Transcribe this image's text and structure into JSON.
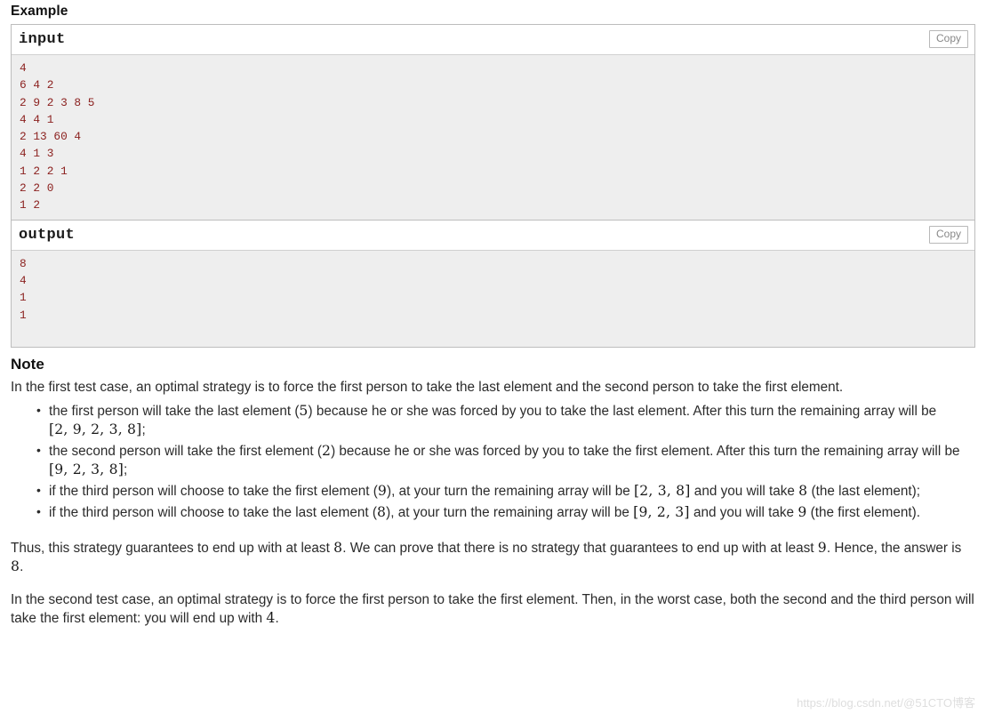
{
  "example": {
    "heading": "Example",
    "blocks": [
      {
        "title": "input",
        "copy_label": "Copy",
        "content": "4\n6 4 2\n2 9 2 3 8 5\n4 4 1\n2 13 60 4\n4 1 3\n1 2 2 1\n2 2 0\n1 2"
      },
      {
        "title": "output",
        "copy_label": "Copy",
        "content": "8\n4\n1\n1"
      }
    ]
  },
  "note": {
    "heading": "Note",
    "intro": "In the first test case, an optimal strategy is to force the first person to take the last element and the second person to take the first element.",
    "bullets": [
      {
        "t1": "the first person will take the last element (",
        "m1": "5",
        "t2": ") because he or she was forced by you to take the last element. After this turn the remaining array will be ",
        "m2": "[2, 9, 2, 3, 8]",
        "t3": ";"
      },
      {
        "t1": "the second person will take the first element (",
        "m1": "2",
        "t2": ") because he or she was forced by you to take the first element. After this turn the remaining array will be ",
        "m2": "[9, 2, 3, 8]",
        "t3": ";"
      },
      {
        "t1": "if the third person will choose to take the first element (",
        "m1": "9",
        "t2": "), at your turn the remaining array will be ",
        "m2": "[2, 3, 8]",
        "t3": " and you will take ",
        "m3": "8",
        "t4": " (the last element);"
      },
      {
        "t1": "if the third person will choose to take the last element (",
        "m1": "8",
        "t2": "), at your turn the remaining array will be ",
        "m2": "[9, 2, 3]",
        "t3": " and you will take ",
        "m3": "9",
        "t4": " (the first element)."
      }
    ],
    "conclusion": {
      "t1": "Thus, this strategy guarantees to end up with at least ",
      "m1": "8",
      "t2": ". We can prove that there is no strategy that guarantees to end up with at least ",
      "m2": "9",
      "t3": ". Hence, the answer is ",
      "m3": "8",
      "t4": "."
    },
    "second_case": {
      "t1": "In the second test case, an optimal strategy is to force the first person to take the first element. Then, in the worst case, both the second and the third person will take the first element: you will end up with ",
      "m1": "4",
      "t2": "."
    }
  },
  "watermark": {
    "text": "https://blog.csdn.net/@51CTO博客"
  }
}
